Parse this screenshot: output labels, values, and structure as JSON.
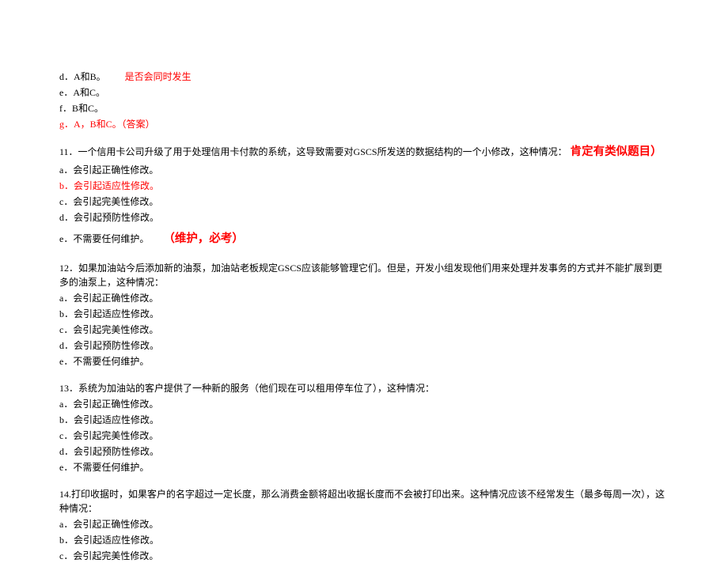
{
  "block_d": {
    "d": "d．A和B。",
    "d_anno": "是否会同时发生",
    "e": "e．A和C。",
    "f": "f．B和C。",
    "g": "g．A，B和C。（答案）"
  },
  "q11": {
    "stem_pre": "11．一个信用卡公司升级了用于处理信用卡付款的系统，这导致需要对GSCS所发送的数据结构的一个小修改，这种情况：",
    "stem_anno": "肯定有类似题目）",
    "a": "a．会引起正确性修改。",
    "b": "b．会引起适应性修改。",
    "c": "c．会引起完美性修改。",
    "d": "d．会引起预防性修改。",
    "e": "e．不需要任何维护。",
    "e_anno": "（维护，必考）"
  },
  "q12": {
    "stem": "12．如果加油站今后添加新的油泵，加油站老板规定GSCS应该能够管理它们。但是，开发小组发现他们用来处理并发事务的方式并不能扩展到更多的油泵上，这种情况：",
    "a": "a．会引起正确性修改。",
    "b": "b．会引起适应性修改。",
    "c": "c．会引起完美性修改。",
    "d": "d．会引起预防性修改。",
    "e": "e．不需要任何维护。"
  },
  "q13": {
    "stem": "13．系统为加油站的客户提供了一种新的服务（他们现在可以租用停车位了），这种情况：",
    "a": "a．会引起正确性修改。",
    "b": "b．会引起适应性修改。",
    "c": "c．会引起完美性修改。",
    "d": "d．会引起预防性修改。",
    "e": "e．不需要任何维护。"
  },
  "q14": {
    "stem": "14.打印收据时，如果客户的名字超过一定长度，那么消费金额将超出收据长度而不会被打印出来。这种情况应该不经常发生（最多每周一次），这种情况：",
    "a": "a．会引起正确性修改。",
    "b": "b．会引起适应性修改。",
    "c": "c．会引起完美性修改。"
  }
}
